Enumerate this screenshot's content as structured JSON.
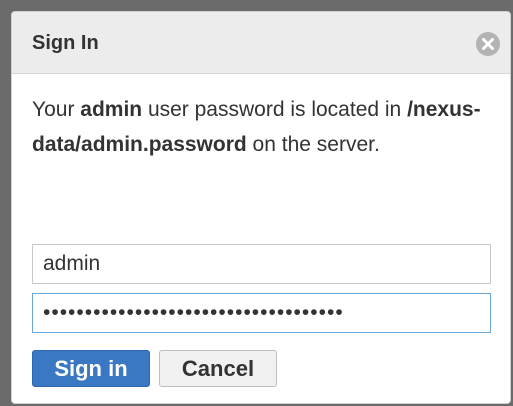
{
  "dialog": {
    "title": "Sign In",
    "close_icon": "close-circle-icon"
  },
  "message": {
    "part1": "Your ",
    "user": "admin",
    "part2": " user password is located in ",
    "path": "/nexus-data/admin.password",
    "part3": " on the server."
  },
  "form": {
    "username_value": "admin",
    "password_value": "••••••••••••••••••••••••••••••••••••"
  },
  "buttons": {
    "signin_label": "Sign in",
    "cancel_label": "Cancel"
  },
  "colors": {
    "primary": "#3a78c4",
    "header_bg": "#ececec",
    "focus_border": "#6aa6d6"
  }
}
